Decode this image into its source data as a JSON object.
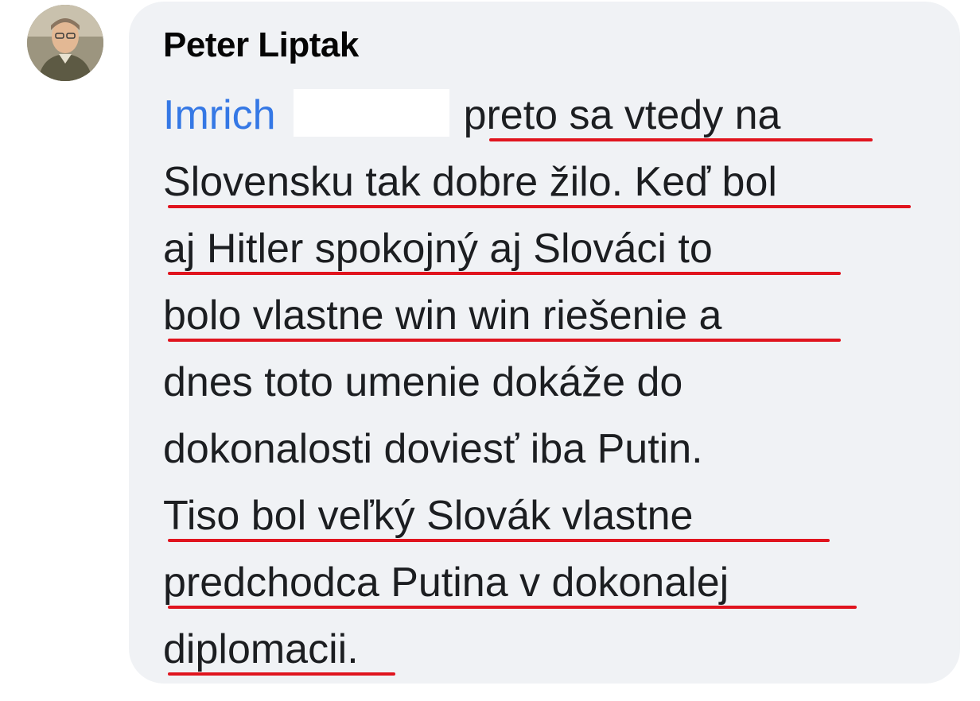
{
  "comment": {
    "author": "Peter Liptak",
    "mention": "Imrich",
    "lines": [
      "preto sa vtedy na",
      "Slovensku tak dobre žilo. Keď bol",
      "aj Hitler spokojný aj Slováci to",
      "bolo vlastne win win riešenie a",
      "dnes toto umenie dokáže do",
      "dokonalosti doviesť iba Putin.",
      "Tiso bol veľký Slovák  vlastne",
      "predchodca Putina v dokonalej",
      "diplomacii."
    ]
  },
  "colors": {
    "bubble": "#f0f2f5",
    "mention": "#3578e5",
    "underline": "#e0141e",
    "text": "#1c1e21"
  },
  "icons": {
    "avatar": "profile-photo"
  }
}
